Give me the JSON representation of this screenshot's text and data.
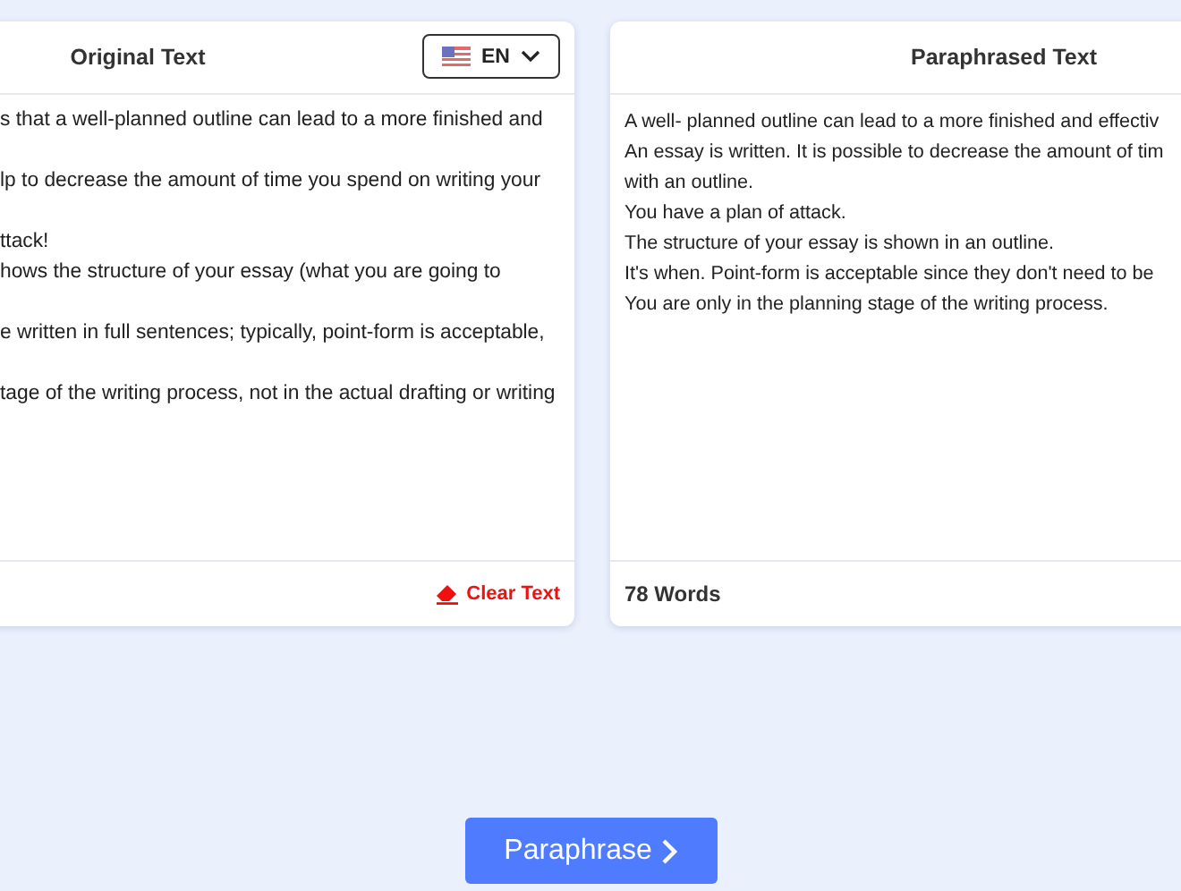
{
  "original": {
    "title": "Original Text",
    "language": "EN",
    "paragraphs": [
      [
        "s that a well-planned outline can lead to a more finished and"
      ],
      [
        "lp to decrease the amount of time you spend on writing your"
      ],
      [
        "ttack!",
        "hows the structure of your essay (what you are going to"
      ],
      [
        "e written in full sentences; typically, point-form is acceptable,"
      ],
      [
        "tage of the writing process, not in the actual drafting or writing"
      ]
    ],
    "clear_button": "Clear Text"
  },
  "paraphrased": {
    "title": "Paraphrased Text",
    "lines": [
      "A well- planned outline can lead to a more finished and effectiv",
      "An essay is written. It is possible to decrease the amount of tim",
      "with an outline.",
      "You have a plan of attack.",
      "The structure of your essay is shown in an outline.",
      "It's when. Point-form is acceptable since they don't need to be",
      "You are only in the planning stage of the writing process."
    ],
    "word_count": "78 Words"
  },
  "action_button": "Paraphrase"
}
